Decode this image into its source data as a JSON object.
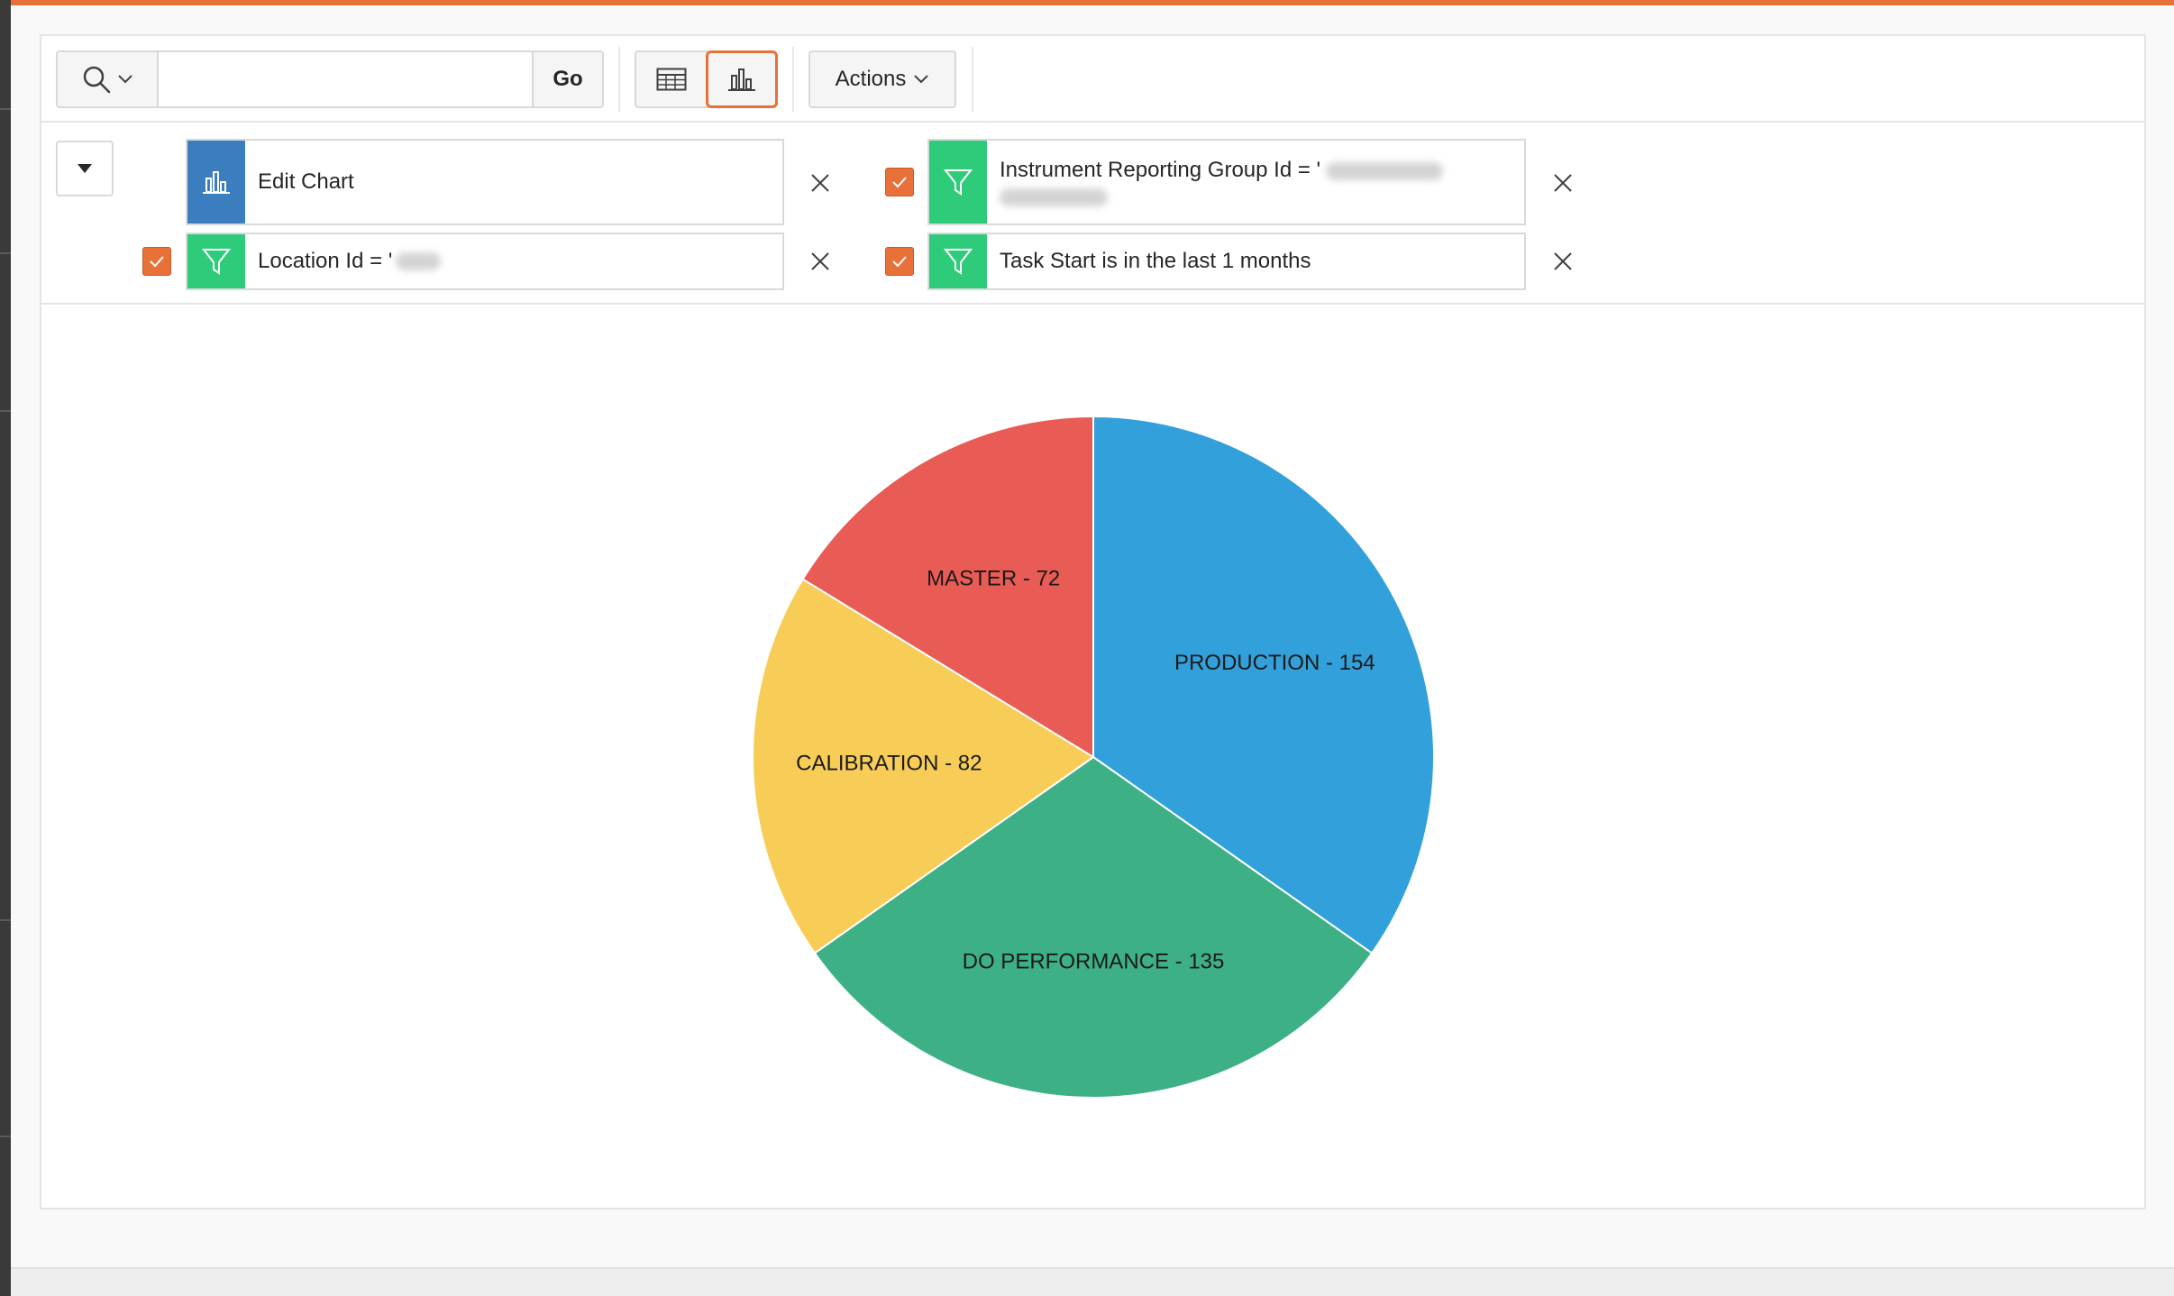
{
  "toolbar": {
    "search_placeholder": "",
    "search_value": "",
    "go_label": "Go",
    "actions_label": "Actions"
  },
  "report_settings": {
    "edit_chart_label": "Edit Chart",
    "filters": [
      {
        "label": "Instrument Reporting Group Id = '",
        "enabled": true
      },
      {
        "label": "Location Id = '",
        "enabled": true
      },
      {
        "label": "Task Start is in the last 1 months",
        "enabled": true
      }
    ]
  },
  "colors": {
    "accent": "#e8713a",
    "chart_chip": "#3b7ec0",
    "filter_chip": "#2ecc7a"
  },
  "icons": [
    "search-icon",
    "chevron-down-icon",
    "grid-view-icon",
    "bar-chart-icon",
    "filter-icon",
    "close-icon",
    "caret-down-icon",
    "checkmark-icon"
  ],
  "chart_data": {
    "type": "pie",
    "title": "",
    "slices": [
      {
        "label": "PRODUCTION - 154",
        "category": "PRODUCTION",
        "value": 154,
        "color": "#32a0da"
      },
      {
        "label": "DO PERFORMANCE - 135",
        "category": "DO PERFORMANCE",
        "value": 135,
        "color": "#3eb086"
      },
      {
        "label": "CALIBRATION - 82",
        "category": "CALIBRATION",
        "value": 82,
        "color": "#f8cd57"
      },
      {
        "label": "MASTER - 72",
        "category": "MASTER",
        "value": 72,
        "color": "#e85c55"
      }
    ]
  }
}
